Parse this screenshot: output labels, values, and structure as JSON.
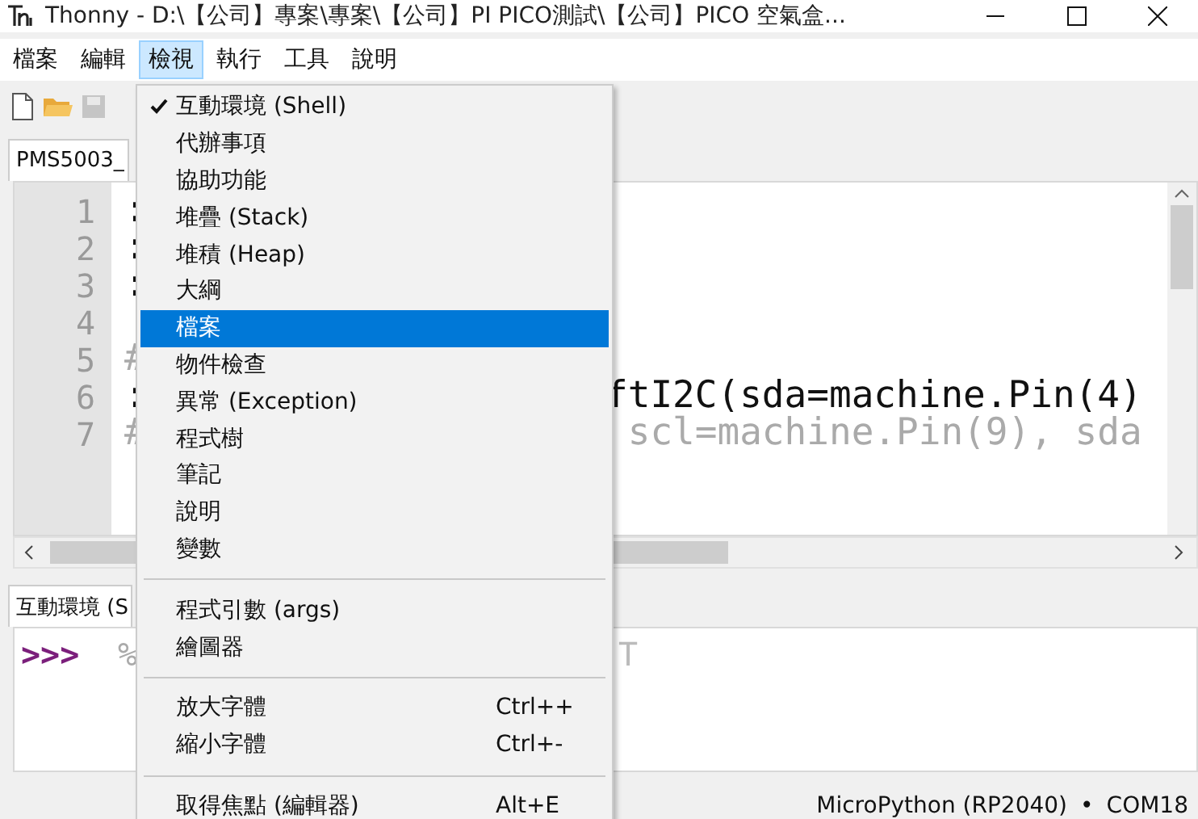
{
  "window": {
    "title": "Thonny  -  D:\\【公司】專案\\專案\\【公司】PI PICO測試\\【公司】PICO 空氣盒..."
  },
  "menu_bar": [
    {
      "label": "檔案",
      "selected": false
    },
    {
      "label": "編輯",
      "selected": false
    },
    {
      "label": "檢視",
      "selected": true
    },
    {
      "label": "執行",
      "selected": false
    },
    {
      "label": "工具",
      "selected": false
    },
    {
      "label": "說明",
      "selected": false
    }
  ],
  "toolbar": [
    {
      "kind": "new",
      "disabled": false
    },
    {
      "kind": "open",
      "disabled": false
    },
    {
      "kind": "save",
      "disabled": true
    }
  ],
  "editor_tab": {
    "label": "PMS5003_"
  },
  "editor": {
    "lines": [
      {
        "number": "1",
        "left": ":"
      },
      {
        "number": "2",
        "left": ":"
      },
      {
        "number": "3",
        "left": ":"
      },
      {
        "number": "4"
      },
      {
        "number": "5",
        "left": "#",
        "comment": true
      },
      {
        "number": "6",
        "left": ":",
        "right": "ftI2C(sda=machine.Pin(4)"
      },
      {
        "number": "7",
        "left": "#",
        "right": " scl=machine.Pin(9), sda",
        "comment": true
      }
    ]
  },
  "shell_tab": {
    "label": "互動環境 (S"
  },
  "shell": {
    "prompt": ">>>",
    "left": "%",
    "right": "T"
  },
  "view_menu": [
    {
      "kind": "item",
      "label": "互動環境 (Shell)",
      "checked": true,
      "selected": false
    },
    {
      "kind": "item",
      "label": "代辦事項",
      "checked": false,
      "selected": false
    },
    {
      "kind": "item",
      "label": "協助功能",
      "checked": false,
      "selected": false
    },
    {
      "kind": "item",
      "label": "堆疊 (Stack)",
      "checked": false,
      "selected": false
    },
    {
      "kind": "item",
      "label": "堆積 (Heap)",
      "checked": false,
      "selected": false
    },
    {
      "kind": "item",
      "label": "大綱",
      "checked": false,
      "selected": false
    },
    {
      "kind": "item",
      "label": "檔案",
      "checked": false,
      "selected": true
    },
    {
      "kind": "item",
      "label": "物件檢查",
      "checked": false,
      "selected": false
    },
    {
      "kind": "item",
      "label": "異常 (Exception)",
      "checked": false,
      "selected": false
    },
    {
      "kind": "item",
      "label": "程式樹",
      "checked": false,
      "selected": false
    },
    {
      "kind": "item",
      "label": "筆記",
      "checked": false,
      "selected": false
    },
    {
      "kind": "item",
      "label": "說明",
      "checked": false,
      "selected": false
    },
    {
      "kind": "item",
      "label": "變數",
      "checked": false,
      "selected": false
    },
    {
      "kind": "separator"
    },
    {
      "kind": "item",
      "label": "程式引數 (args)",
      "checked": false,
      "selected": false
    },
    {
      "kind": "item",
      "label": "繪圖器",
      "checked": false,
      "selected": false
    },
    {
      "kind": "separator"
    },
    {
      "kind": "item",
      "label": "放大字體",
      "shortcut": "Ctrl++",
      "checked": false,
      "selected": false
    },
    {
      "kind": "item",
      "label": "縮小字體",
      "shortcut": "Ctrl+-",
      "checked": false,
      "selected": false
    },
    {
      "kind": "separator"
    },
    {
      "kind": "item",
      "label": "取得焦點 (編輯器)",
      "shortcut": "Alt+E",
      "checked": false,
      "selected": false
    }
  ],
  "status_bar": {
    "interpreter": "MicroPython (RP2040)",
    "separator": "•",
    "port": "COM18"
  }
}
